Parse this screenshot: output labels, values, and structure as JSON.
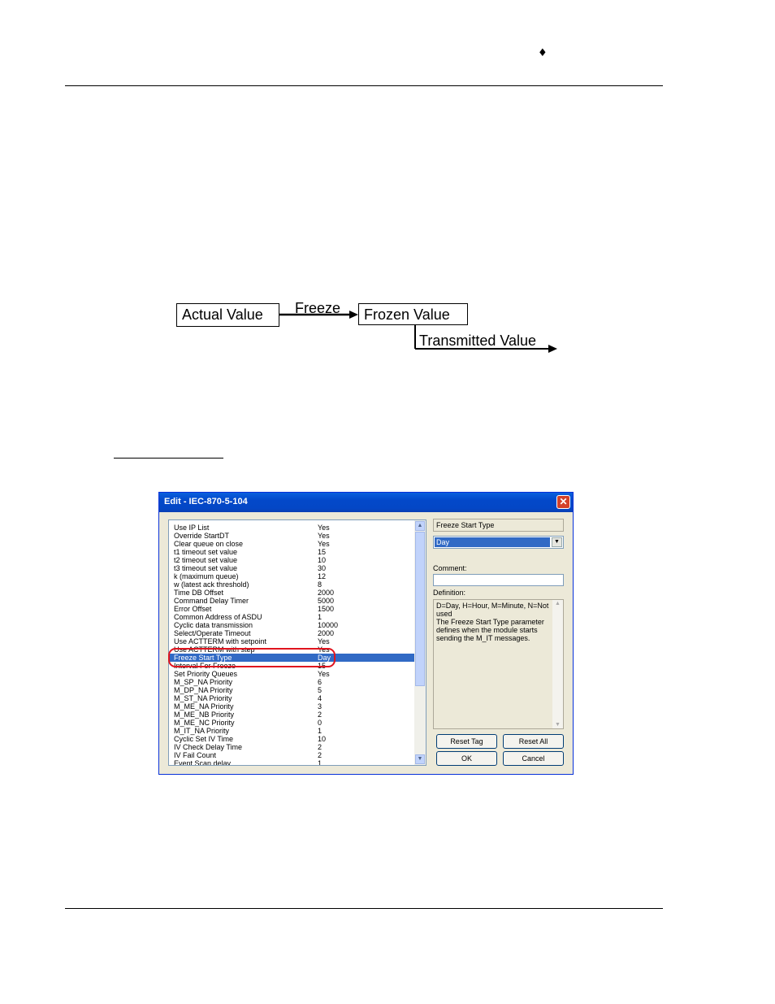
{
  "header": {
    "marker": "♦"
  },
  "diagram": {
    "actual": "Actual Value",
    "freeze": "Freeze",
    "frozen": "Frozen Value",
    "transmitted": "Transmitted Value"
  },
  "dialog": {
    "title": "Edit - IEC-870-5-104",
    "close_label": "✕",
    "params": [
      {
        "name": "Use IP List",
        "value": "Yes"
      },
      {
        "name": "Override StartDT",
        "value": "Yes"
      },
      {
        "name": "Clear queue on close",
        "value": "Yes"
      },
      {
        "name": "t1 timeout set value",
        "value": "15"
      },
      {
        "name": "t2 timeout set value",
        "value": "10"
      },
      {
        "name": "t3 timeout set value",
        "value": "30"
      },
      {
        "name": "k (maximum queue)",
        "value": "12"
      },
      {
        "name": "w (latest ack threshold)",
        "value": "8"
      },
      {
        "name": "Time DB Offset",
        "value": "2000"
      },
      {
        "name": "Command Delay Timer",
        "value": "5000"
      },
      {
        "name": "Error Offset",
        "value": "1500"
      },
      {
        "name": "Common Address of ASDU",
        "value": "1"
      },
      {
        "name": "Cyclic data transmission",
        "value": "10000"
      },
      {
        "name": "Select/Operate Timeout",
        "value": "2000"
      },
      {
        "name": "Use ACTTERM with setpoint",
        "value": "Yes"
      },
      {
        "name": "Use ACTTERM with step",
        "value": "Yes"
      },
      {
        "name": "Freeze Start Type",
        "value": "Day"
      },
      {
        "name": "Interval For Freeze",
        "value": "15"
      },
      {
        "name": "Set Priority Queues",
        "value": "Yes"
      },
      {
        "name": "M_SP_NA Priority",
        "value": "6"
      },
      {
        "name": "M_DP_NA Priority",
        "value": "5"
      },
      {
        "name": "M_ST_NA Priority",
        "value": "4"
      },
      {
        "name": "M_ME_NA Priority",
        "value": "3"
      },
      {
        "name": "M_ME_NB Priority",
        "value": "2"
      },
      {
        "name": "M_ME_NC Priority",
        "value": "0"
      },
      {
        "name": "M_IT_NA Priority",
        "value": "1"
      },
      {
        "name": "Cyclic Set IV Time",
        "value": "10"
      },
      {
        "name": "IV Check Delay Time",
        "value": "2"
      },
      {
        "name": "IV Fail Count",
        "value": "2"
      },
      {
        "name": "Event Scan delay",
        "value": "1"
      }
    ],
    "selected_index": 16,
    "param_name": "Freeze Start Type",
    "dropdown_value": "Day",
    "comment_label": "Comment:",
    "comment_value": "",
    "definition_label": "Definition:",
    "definition_text": "D=Day, H=Hour, M=Minute, N=Not used\nThe Freeze Start Type parameter defines when the module starts sending the M_IT messages.",
    "buttons": {
      "reset_tag": "Reset Tag",
      "reset_all": "Reset All",
      "ok": "OK",
      "cancel": "Cancel"
    },
    "colors": {
      "selection": "#316ac5",
      "highlight_oval": "#e0141e",
      "title_bar": "#0348c9"
    }
  }
}
